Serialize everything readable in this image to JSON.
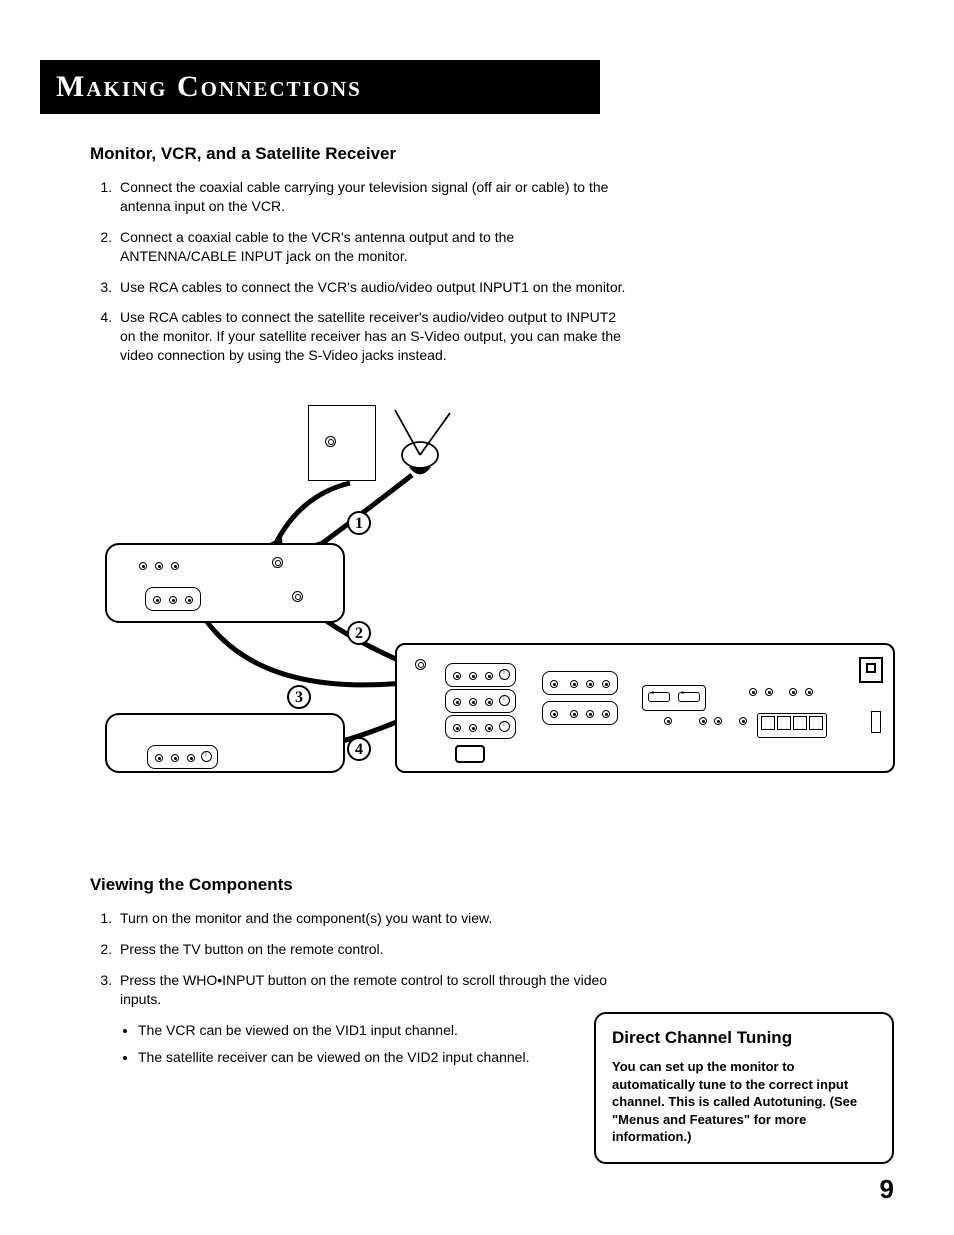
{
  "title": "Making Connections",
  "section1": {
    "heading": "Monitor, VCR, and a Satellite Receiver",
    "steps": [
      "Connect the coaxial cable carrying your television signal (off air or cable) to the antenna input on the VCR.",
      "Connect a coaxial cable to the VCR's antenna output and to the ANTENNA/CABLE INPUT jack on the monitor.",
      "Use RCA cables to connect the VCR's audio/video output INPUT1 on the monitor.",
      "Use RCA cables to connect the satellite receiver's audio/video output to INPUT2 on the monitor. If your satellite receiver has an S-Video output, you can make the video connection by using the S-Video jacks instead."
    ]
  },
  "diagram": {
    "labels": {
      "n1": "1",
      "n2": "2",
      "n3": "3",
      "n4": "4"
    }
  },
  "section2": {
    "heading": "Viewing the Components",
    "steps": [
      "Turn on the monitor and the component(s) you want to view.",
      "Press the TV button on the remote control.",
      "Press the WHO•INPUT button on the remote control to scroll through the video inputs."
    ],
    "bullets": [
      "The VCR can be viewed on the VID1 input channel.",
      "The satellite receiver can be viewed on the VID2 input channel."
    ]
  },
  "sidebar": {
    "heading": "Direct Channel Tuning",
    "body": "You can set up the monitor to automatically tune to the correct input channel. This is called Autotuning. (See \"Menus and Features\" for more information.)"
  },
  "page_number": "9"
}
